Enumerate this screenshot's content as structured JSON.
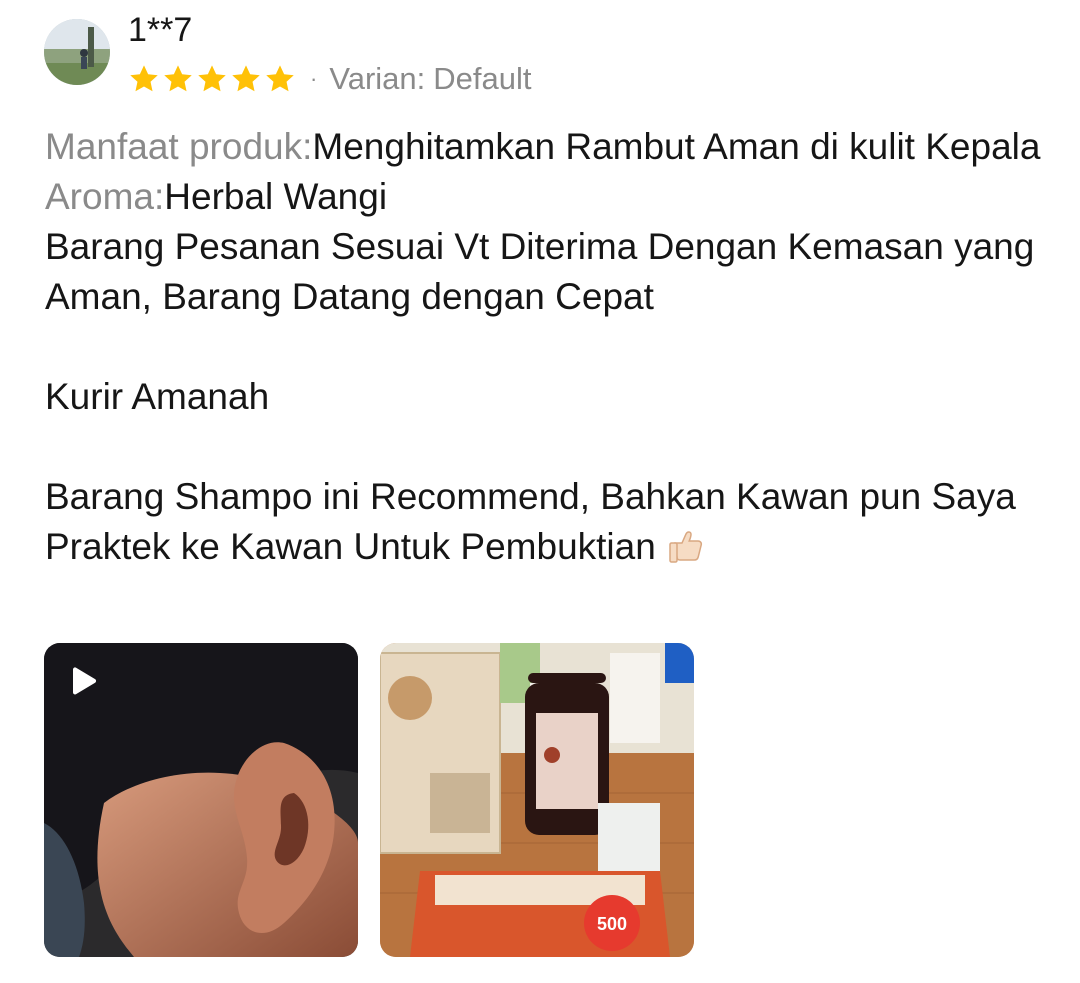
{
  "review": {
    "username": "1**7",
    "rating": 5,
    "rating_max": 5,
    "separator": "·",
    "variant_label": "Varian:",
    "variant_value": "Default",
    "field1_label": "Manfaat produk:",
    "field1_value": "Menghitamkan Rambut Aman di kulit Kepala",
    "field2_label": "Aroma:",
    "field2_value": "Herbal Wangi",
    "line1": "Barang Pesanan Sesuai Vt Diterima Dengan Kemasan yang Aman, Barang Datang dengan Cepat",
    "line2": "Kurir Amanah",
    "line3": "Barang Shampo ini Recommend, Bahkan Kawan pun Saya Praktek ke Kawan Untuk Pembuktian",
    "emoji": "thumbs-up-icon"
  },
  "media": [
    {
      "type": "video",
      "icon": "play-icon"
    },
    {
      "type": "image",
      "printed_text": "500"
    }
  ],
  "colors": {
    "star": "#FFC107",
    "muted_text": "#8A8A8A",
    "body_text": "#161616"
  }
}
